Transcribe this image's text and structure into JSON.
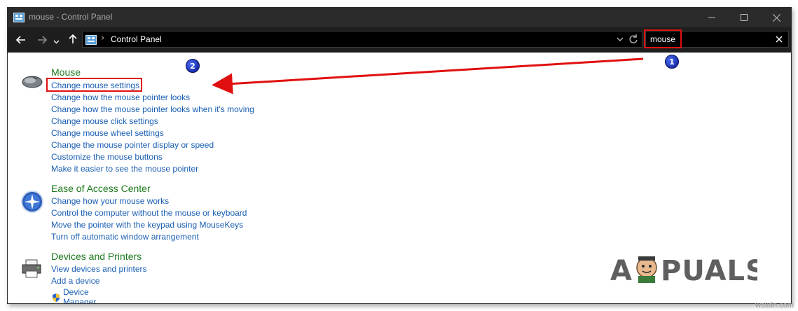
{
  "window": {
    "title": "mouse - Control Panel",
    "breadcrumb": "Control Panel",
    "breadcrumb_separator": "›",
    "search_value": "mouse"
  },
  "icons": {
    "back": "arrow-left-icon",
    "forward": "arrow-right-icon",
    "recent": "chevron-down-icon",
    "up": "arrow-up-icon",
    "refresh": "refresh-icon",
    "clear": "close-icon",
    "minimize": "minimize-icon",
    "maximize": "maximize-icon",
    "close": "close-icon"
  },
  "groups": [
    {
      "title": "Mouse",
      "icon": "mouse-icon",
      "links": [
        "Change mouse settings",
        "Change how the mouse pointer looks",
        "Change how the mouse pointer looks when it's moving",
        "Change mouse click settings",
        "Change mouse wheel settings",
        "Change the mouse pointer display or speed",
        "Customize the mouse buttons",
        "Make it easier to see the mouse pointer"
      ]
    },
    {
      "title": "Ease of Access Center",
      "icon": "ease-of-access-icon",
      "links": [
        "Change how your mouse works",
        "Control the computer without the mouse or keyboard",
        "Move the pointer with the keypad using MouseKeys",
        "Turn off automatic window arrangement"
      ]
    },
    {
      "title": "Devices and Printers",
      "icon": "printer-icon",
      "links": [
        "View devices and printers",
        "Add a device",
        "Device Manager"
      ]
    }
  ],
  "annotations": {
    "badge_1": "1",
    "badge_2": "2",
    "highlight_color": "#e01010",
    "badge_color": "#1b2fb0"
  },
  "watermark": "A  PUALS",
  "footer": "wsxdn.com",
  "colors": {
    "group_title": "#1e7a1e",
    "link": "#1a5fb4",
    "titlebar": "#2b2b2b",
    "navbar": "#1e1e1e"
  }
}
